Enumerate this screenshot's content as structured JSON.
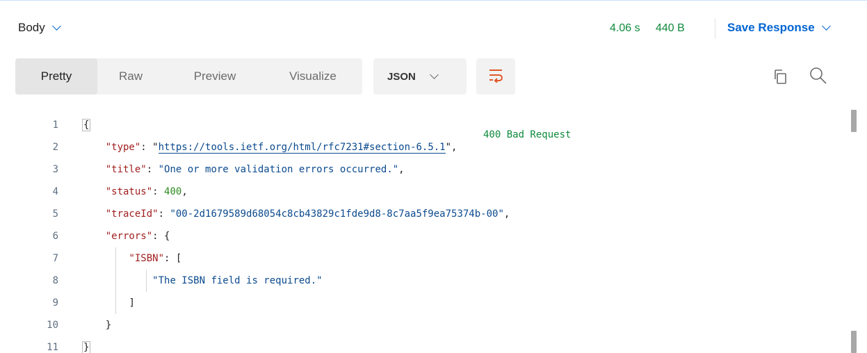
{
  "header": {
    "body_label": "Body",
    "status_code": "400 Bad Request",
    "time": "4.06 s",
    "size": "440 B",
    "save_response_label": "Save Response"
  },
  "tabs": [
    {
      "label": "Pretty",
      "active": true
    },
    {
      "label": "Raw",
      "active": false
    },
    {
      "label": "Preview",
      "active": false
    },
    {
      "label": "Visualize",
      "active": false
    }
  ],
  "format": {
    "selected": "JSON"
  },
  "icons": {
    "body_dropdown": "chevron-down-icon",
    "save_dropdown": "chevron-down-icon",
    "wrap": "word-wrap-icon",
    "copy": "copy-icon",
    "search": "search-icon"
  },
  "colors": {
    "status_ok_text": "#0f8a3c",
    "accent": "#0265d2",
    "wrap_icon": "#e0572a",
    "json_key": "#a11f1f",
    "json_string": "#0b4a8e",
    "json_number": "#2c8a1f"
  },
  "code": {
    "line_numbers": [
      "1",
      "2",
      "3",
      "4",
      "5",
      "6",
      "7",
      "8",
      "9",
      "10",
      "11"
    ],
    "open_brace": "{",
    "type_key": "\"type\"",
    "type_value": "https://tools.ietf.org/html/rfc7231#section-6.5.1",
    "title_key": "\"title\"",
    "title_value": "\"One or more validation errors occurred.\"",
    "status_key": "\"status\"",
    "status_value": "400",
    "traceid_key": "\"traceId\"",
    "traceid_value": "\"00-2d1679589d68054c8cb43829c1fde9d8-8c7aa5f9ea75374b-00\"",
    "errors_key": "\"errors\"",
    "isbn_key": "\"ISBN\"",
    "isbn_message": "\"The ISBN field is required.\"",
    "close_bracket": "]",
    "close_inner_brace": "}",
    "close_brace": "}"
  }
}
